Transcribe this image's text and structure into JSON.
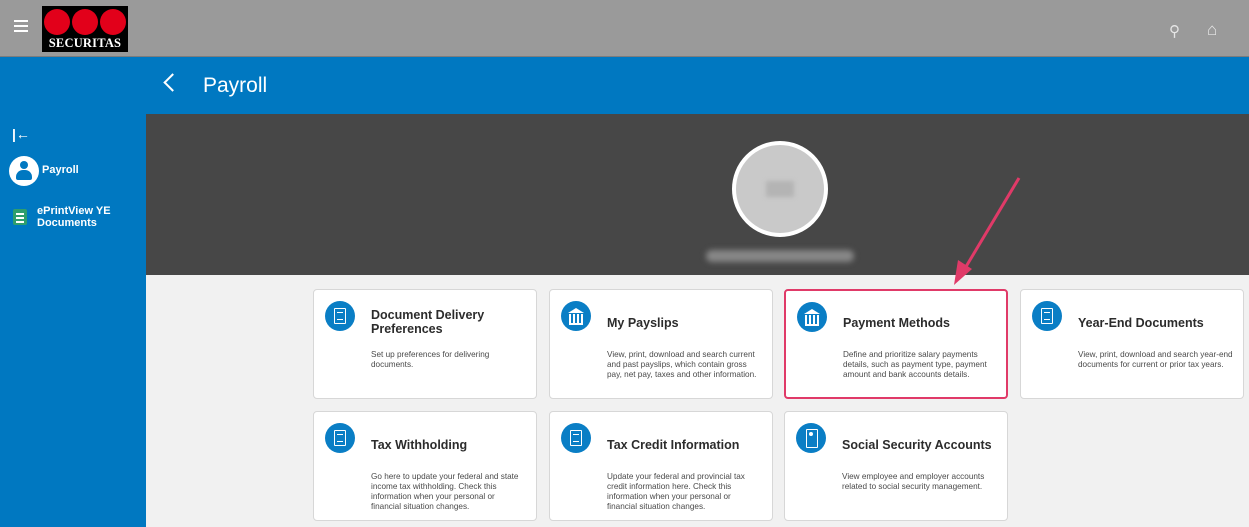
{
  "brand": {
    "logo_text": "SECURITAS",
    "logo_color": "#e2001a"
  },
  "topbar": {
    "icons": [
      "hamburger-icon",
      "search-icon",
      "home-icon"
    ],
    "search_glyph": "⚲",
    "home_glyph": "⌂"
  },
  "header": {
    "title": "Payroll",
    "accent": "#0078c1"
  },
  "sidebar": {
    "collapse_glyph": "|←",
    "items": [
      {
        "label": "Payroll",
        "icon": "person-icon"
      },
      {
        "label": "ePrintView YE Documents",
        "icon": "document-icon"
      }
    ]
  },
  "cards": [
    {
      "title": "Document Delivery Preferences",
      "description": "Set up preferences for delivering documents.",
      "icon": "document-icon"
    },
    {
      "title": "My Payslips",
      "description": "View, print, download and search current and past payslips, which contain gross pay, net pay, taxes and other information.",
      "icon": "bank-icon"
    },
    {
      "title": "Payment Methods",
      "description": "Define and prioritize salary payments details, such as payment type, payment amount and bank accounts details.",
      "icon": "bank-icon",
      "highlighted": true
    },
    {
      "title": "Year-End Documents",
      "description": "View, print, download and search year-end documents for current or prior tax years.",
      "icon": "document-icon"
    },
    {
      "title": "Tax Withholding",
      "description": "Go here to update your federal and state income tax withholding. Check this information when your personal or financial situation changes.",
      "icon": "document-icon"
    },
    {
      "title": "Tax Credit Information",
      "description": "Update your federal and provincial tax credit information here. Check this information when your personal or financial situation changes.",
      "icon": "document-icon"
    },
    {
      "title": "Social Security Accounts",
      "description": "View employee and employer accounts related to social security management.",
      "icon": "id-badge-icon"
    }
  ],
  "annotation": {
    "color": "#e03a68",
    "icon": "arrow-icon"
  }
}
